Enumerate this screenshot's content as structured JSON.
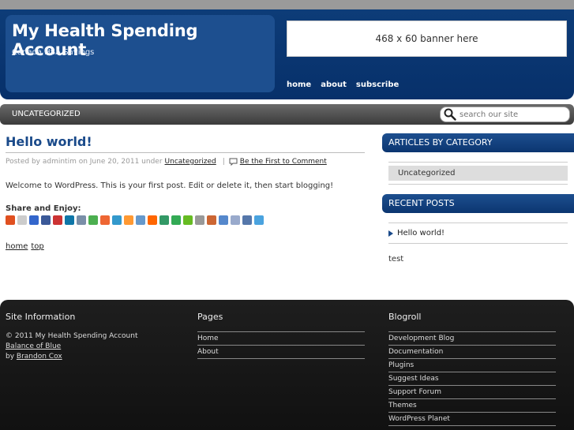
{
  "header": {
    "site_title": "My Health Spending Account",
    "tagline": "Canada HSA Savings",
    "banner": "468 x 60 banner here",
    "nav": [
      "home",
      "about",
      "subscribe"
    ]
  },
  "navbar": {
    "category": "UNCATEGORIZED",
    "search_placeholder": "search our site"
  },
  "post": {
    "title": "Hello world!",
    "meta_prefix": "Posted by admintim on June 20, 2011 under",
    "category": "Uncategorized",
    "separator": "|",
    "comment_link": "Be the First to Comment",
    "body": "Welcome to WordPress. This is your first post. Edit or delete it, then start blogging!",
    "share_title": "Share and Enjoy:",
    "share_colors": [
      "#e05020",
      "#cccccc",
      "#3366cc",
      "#3b5998",
      "#cc3333",
      "#0e76a8",
      "#7a8fa8",
      "#4caf50",
      "#ee6633",
      "#3399cc",
      "#ff9933",
      "#6699cc",
      "#ff6600",
      "#339966",
      "#33aa55",
      "#66bb22",
      "#999999",
      "#cc6633",
      "#5588cc",
      "#99aacc",
      "#5577aa",
      "#4aa3df"
    ],
    "home_link": "home",
    "top_link": "top"
  },
  "sidebar": {
    "articles_heading": "ARTICLES BY CATEGORY",
    "category_item": "Uncategorized",
    "recent_heading": "RECENT POSTS",
    "recent_item": "Hello world!",
    "extra_text": "test"
  },
  "footer": {
    "site_info_heading": "Site Information",
    "copyright": "© 2011 My Health Spending Account",
    "theme_link": "Balance of Blue",
    "by_text": "by",
    "author_link": "Brandon Cox",
    "pages_heading": "Pages",
    "pages": [
      "Home",
      "About"
    ],
    "blogroll_heading": "Blogroll",
    "blogroll": [
      "Development Blog",
      "Documentation",
      "Plugins",
      "Suggest Ideas",
      "Support Forum",
      "Themes",
      "WordPress Planet"
    ]
  }
}
